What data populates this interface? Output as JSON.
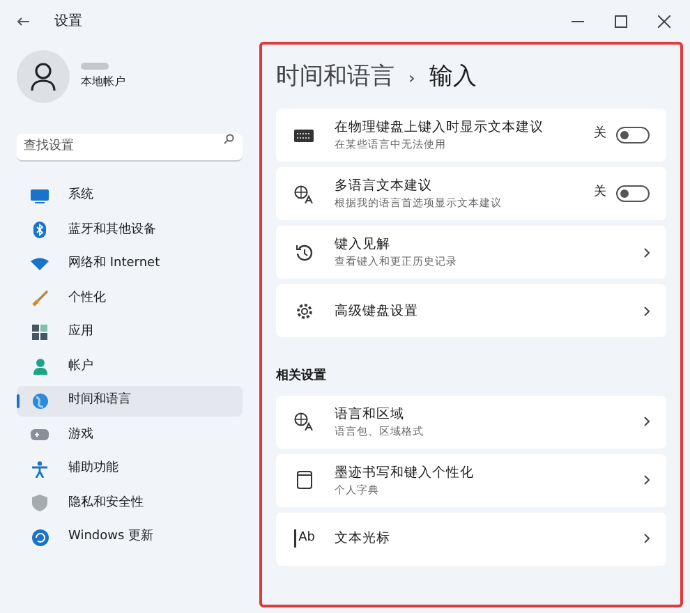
{
  "window": {
    "title": "设置"
  },
  "account": {
    "type": "本地帐户"
  },
  "search": {
    "placeholder": "查找设置"
  },
  "nav": [
    {
      "label": "系统",
      "selected": false
    },
    {
      "label": "蓝牙和其他设备",
      "selected": false
    },
    {
      "label": "网络和 Internet",
      "selected": false
    },
    {
      "label": "个性化",
      "selected": false
    },
    {
      "label": "应用",
      "selected": false
    },
    {
      "label": "帐户",
      "selected": false
    },
    {
      "label": "时间和语言",
      "selected": true
    },
    {
      "label": "游戏",
      "selected": false
    },
    {
      "label": "辅助功能",
      "selected": false
    },
    {
      "label": "隐私和安全性",
      "selected": false
    },
    {
      "label": "Windows 更新",
      "selected": false
    }
  ],
  "breadcrumb": {
    "parent": "时间和语言",
    "separator": "›",
    "current": "输入"
  },
  "cards": [
    {
      "kind": "toggle",
      "title": "在物理键盘上键入时显示文本建议",
      "subtitle": "在某些语言中无法使用",
      "state_label": "关",
      "on": false
    },
    {
      "kind": "toggle",
      "title": "多语言文本建议",
      "subtitle": "根据我的语言首选项显示文本建议",
      "state_label": "关",
      "on": false
    },
    {
      "kind": "link",
      "title": "键入见解",
      "subtitle": "查看键入和更正历史记录"
    },
    {
      "kind": "link",
      "title": "高级键盘设置"
    }
  ],
  "related": {
    "heading": "相关设置",
    "cards": [
      {
        "kind": "link",
        "title": "语言和区域",
        "subtitle": "语言包、区域格式"
      },
      {
        "kind": "link",
        "title": "墨迹书写和键入个性化",
        "subtitle": "个人字典"
      },
      {
        "kind": "link",
        "icon_label": "Ab",
        "title": "文本光标"
      }
    ]
  }
}
